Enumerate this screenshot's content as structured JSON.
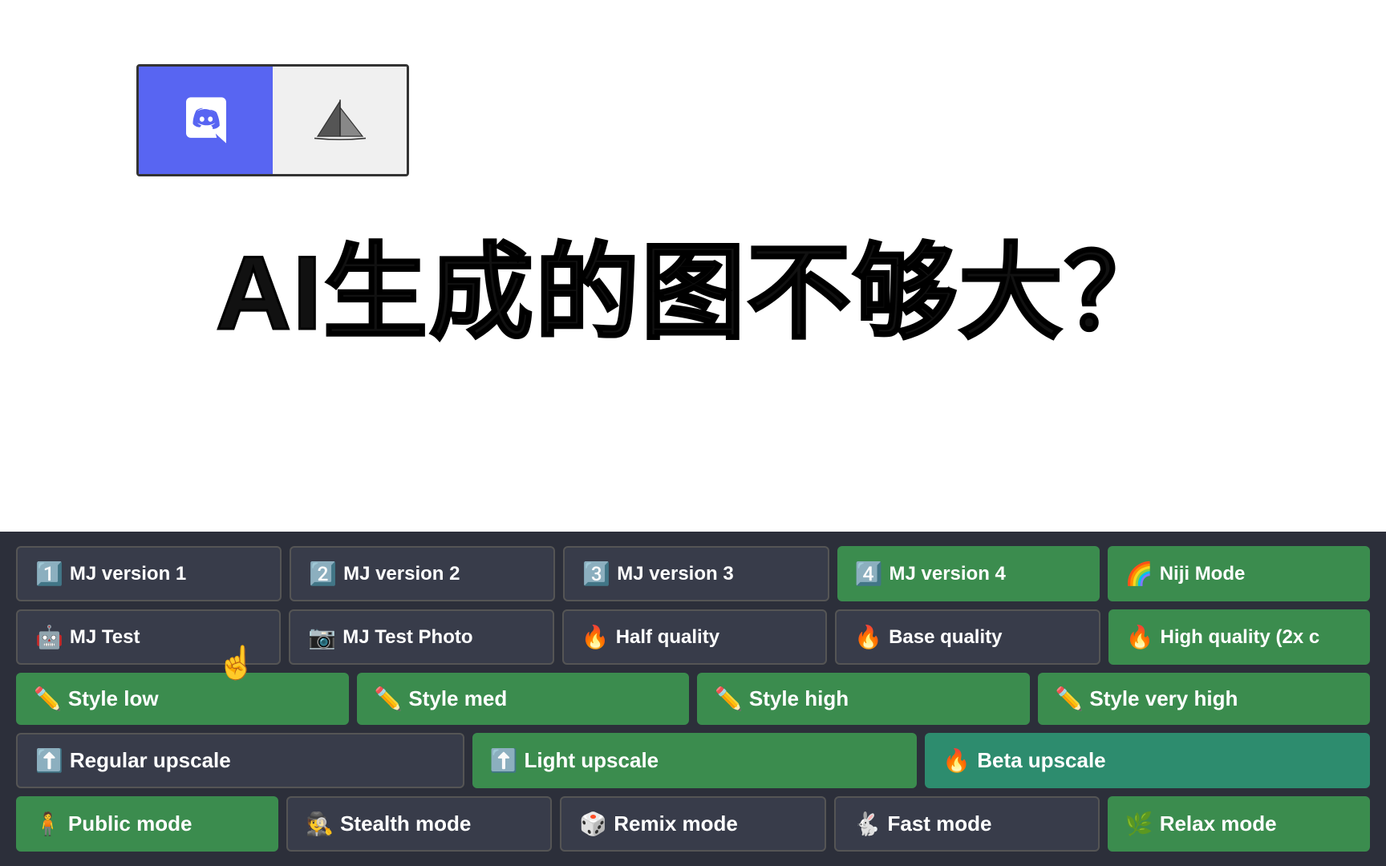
{
  "logo": {
    "discord_bg": "#5865F2",
    "mj_bg": "#f0f0f0"
  },
  "title": "AI生成的图不够大？",
  "rows": [
    {
      "id": "row1",
      "buttons": [
        {
          "id": "mj-v1",
          "icon": "1️⃣",
          "label": "MJ version 1",
          "style": "dark"
        },
        {
          "id": "mj-v2",
          "icon": "2️⃣",
          "label": "MJ version 2",
          "style": "dark"
        },
        {
          "id": "mj-v3",
          "icon": "3️⃣",
          "label": "MJ version 3",
          "style": "dark"
        },
        {
          "id": "mj-v4",
          "icon": "4️⃣",
          "label": "MJ version 4",
          "style": "green"
        },
        {
          "id": "niji",
          "icon": "🌈",
          "label": "Niji Mode",
          "style": "green"
        }
      ]
    },
    {
      "id": "row2",
      "buttons": [
        {
          "id": "mj-test",
          "icon": "🤖",
          "label": "MJ Test",
          "style": "dark"
        },
        {
          "id": "mj-test-photo",
          "icon": "📷",
          "label": "MJ Test Photo",
          "style": "dark"
        },
        {
          "id": "half-quality",
          "icon": "🔥",
          "label": "Half quality",
          "style": "dark"
        },
        {
          "id": "base-quality",
          "icon": "🔥",
          "label": "Base quality",
          "style": "dark"
        },
        {
          "id": "high-quality",
          "icon": "🔥",
          "label": "High quality (2x c",
          "style": "green"
        }
      ]
    },
    {
      "id": "row3",
      "buttons": [
        {
          "id": "style-low",
          "icon": "✏️",
          "label": "Style low",
          "style": "green"
        },
        {
          "id": "style-med",
          "icon": "✏️",
          "label": "Style med",
          "style": "green"
        },
        {
          "id": "style-high",
          "icon": "✏️",
          "label": "Style high",
          "style": "green"
        },
        {
          "id": "style-very-high",
          "icon": "✏️",
          "label": "Style very high",
          "style": "green"
        }
      ]
    },
    {
      "id": "row4",
      "buttons": [
        {
          "id": "regular-upscale",
          "icon": "⬆️",
          "label": "Regular upscale",
          "style": "dark"
        },
        {
          "id": "light-upscale",
          "icon": "⬆️",
          "label": "Light upscale",
          "style": "green"
        },
        {
          "id": "beta-upscale",
          "icon": "🔥",
          "label": "Beta upscale",
          "style": "teal"
        }
      ]
    },
    {
      "id": "row5",
      "buttons": [
        {
          "id": "public-mode",
          "icon": "🧍",
          "label": "Public mode",
          "style": "green"
        },
        {
          "id": "stealth-mode",
          "icon": "🕵️",
          "label": "Stealth mode",
          "style": "dark"
        },
        {
          "id": "remix-mode",
          "icon": "🎲",
          "label": "Remix mode",
          "style": "dark"
        },
        {
          "id": "fast-mode",
          "icon": "🐇",
          "label": "Fast mode",
          "style": "dark"
        },
        {
          "id": "relax-mode",
          "icon": "🌿",
          "label": "Relax mode",
          "style": "green"
        }
      ]
    }
  ]
}
